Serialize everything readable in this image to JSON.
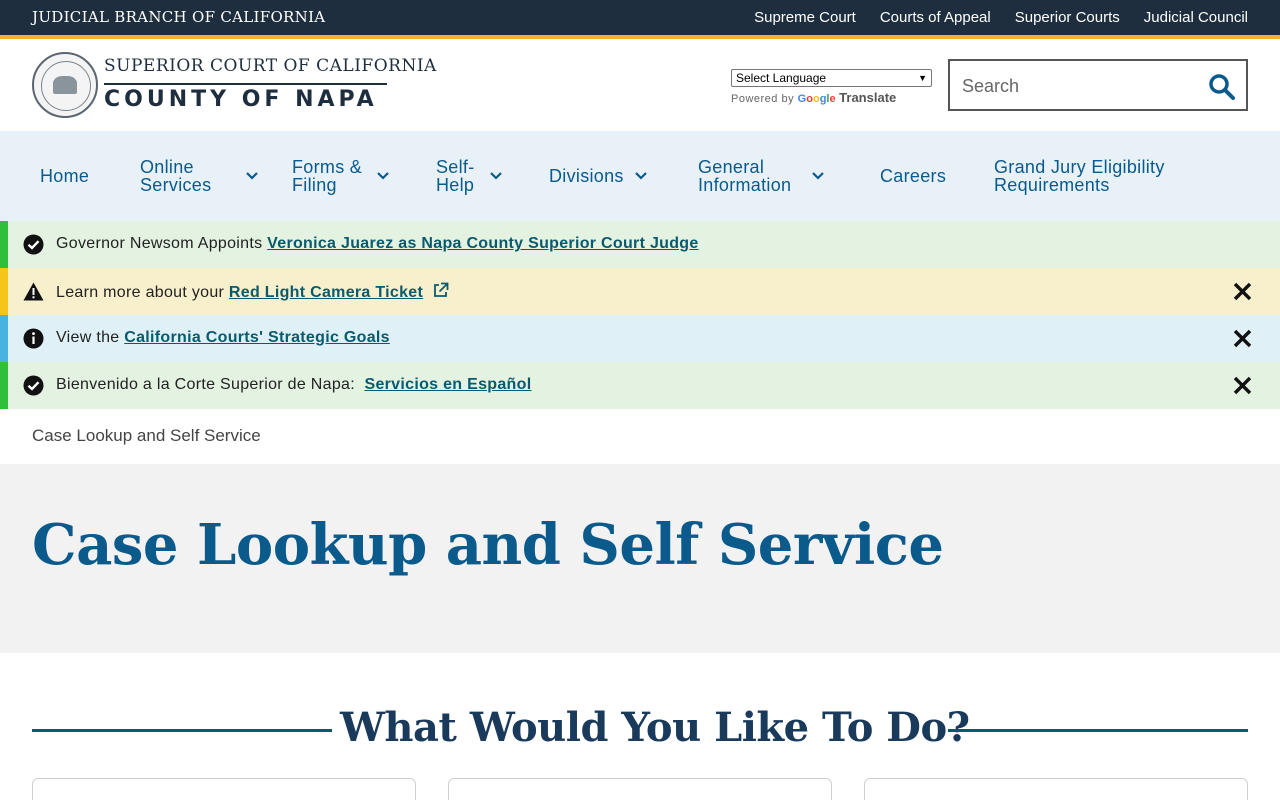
{
  "topbar": {
    "branch_name": "JUDICIAL BRANCH OF CALIFORNIA",
    "links": [
      {
        "label": "Supreme Court"
      },
      {
        "label": "Courts of Appeal"
      },
      {
        "label": "Superior Courts"
      },
      {
        "label": "Judicial Council"
      }
    ],
    "accent_color": "#f0b429",
    "background_color": "#1e2e3e"
  },
  "header": {
    "logo_icon": "court-seal-icon",
    "court_line1": "SUPERIOR COURT OF CALIFORNIA",
    "court_line2": "COUNTY OF NAPA",
    "language_select": {
      "selected": "Select Language"
    },
    "powered_by": "Powered by",
    "google_letters": [
      "G",
      "o",
      "o",
      "g",
      "l",
      "e"
    ],
    "translate_label": "Translate",
    "search": {
      "placeholder": "Search",
      "value": "",
      "icon": "search-icon"
    }
  },
  "nav": {
    "items": [
      {
        "line1": "Home",
        "line2": "",
        "dropdown": false
      },
      {
        "line1": "Online",
        "line2": "Services",
        "dropdown": true
      },
      {
        "line1": "Forms &",
        "line2": "Filing",
        "dropdown": true
      },
      {
        "line1": "Self-",
        "line2": "Help",
        "dropdown": true
      },
      {
        "line1": "Divisions",
        "line2": "",
        "dropdown": true
      },
      {
        "line1": "General",
        "line2": "Information",
        "dropdown": true
      },
      {
        "line1": "Careers",
        "line2": "",
        "dropdown": false
      },
      {
        "line1": "Grand Jury Eligibility",
        "line2": "Requirements",
        "dropdown": false
      }
    ],
    "link_color": "#0a5a8c",
    "background_color": "#e8f1f8"
  },
  "alerts": [
    {
      "type": "success",
      "icon": "check-circle-icon",
      "prefix": "Governor Newsom Appoints ",
      "link": "Veronica Juarez as Napa County Superior Court Judge",
      "dismissible": false,
      "external": false
    },
    {
      "type": "warning",
      "icon": "warning-triangle-icon",
      "prefix": "Learn more about your ",
      "link": "Red Light Camera Ticket",
      "dismissible": true,
      "external": true
    },
    {
      "type": "info",
      "icon": "info-circle-icon",
      "prefix": "View the ",
      "link": "California Courts' Strategic Goals",
      "dismissible": true,
      "external": false
    },
    {
      "type": "success",
      "icon": "check-circle-icon",
      "prefix": "Bienvenido a la Corte Superior de Napa:  ",
      "link": "Servicios en Español",
      "dismissible": true,
      "external": false
    }
  ],
  "breadcrumb": "Case Lookup and Self Service",
  "hero": {
    "title": "Case Lookup and Self Service"
  },
  "section": {
    "title": "What Would You Like To Do?"
  }
}
